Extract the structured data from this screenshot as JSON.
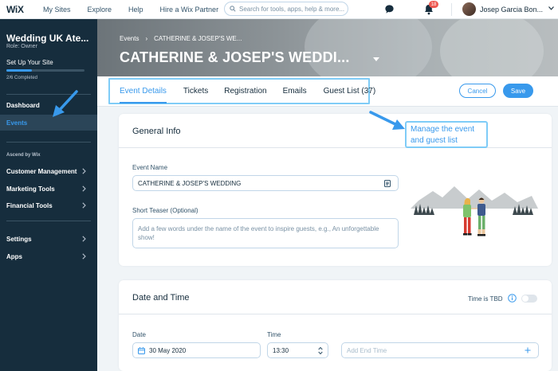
{
  "topbar": {
    "logo": "WiX",
    "nav": [
      "My Sites",
      "Explore",
      "Help",
      "Hire a Wix Partner"
    ],
    "search_placeholder": "Search for tools, apps, help & more...",
    "notifications_count": "18",
    "user_name": "Josep Garcia Bon..."
  },
  "sidebar": {
    "site_name": "Wedding UK Ate...",
    "role": "Role: Owner",
    "setup_label": "Set Up Your Site",
    "setup_progress": 0.33,
    "setup_count": "2/6 Completed",
    "items": [
      {
        "label": "Dashboard"
      },
      {
        "label": "Events"
      }
    ],
    "section_label": "Ascend by Wix",
    "groups": [
      {
        "label": "Customer Management"
      },
      {
        "label": "Marketing Tools"
      },
      {
        "label": "Financial Tools"
      }
    ],
    "bottom": [
      {
        "label": "Settings"
      },
      {
        "label": "Apps"
      }
    ]
  },
  "header": {
    "crumbs": [
      "Events",
      "CATHERINE & JOSEP'S WE..."
    ],
    "title": "CATHERINE & JOSEP'S WEDDI..."
  },
  "tabs": [
    {
      "label": "Event Details",
      "active": true
    },
    {
      "label": "Tickets"
    },
    {
      "label": "Registration"
    },
    {
      "label": "Emails"
    },
    {
      "label": "Guest List (37)"
    }
  ],
  "actions": {
    "cancel": "Cancel",
    "save": "Save"
  },
  "general_info": {
    "title": "General Info",
    "event_name_label": "Event Name",
    "event_name_value": "CATHERINE & JOSEP'S WEDDING",
    "teaser_label": "Short Teaser (Optional)",
    "teaser_placeholder": "Add a few words under the name of the event to inspire guests, e.g., An unforgettable show!"
  },
  "callout": {
    "text": "Manage the event and guest list"
  },
  "date_time": {
    "title": "Date and Time",
    "tbd_label": "Time is TBD",
    "date_label": "Date",
    "date_value": "30 May 2020",
    "time_label": "Time",
    "time_value": "13:30",
    "end_time_placeholder": "Add End Time"
  },
  "colors": {
    "accent": "#3899ec",
    "sidebar": "#162d3d",
    "highlight": "#7fccf7"
  }
}
